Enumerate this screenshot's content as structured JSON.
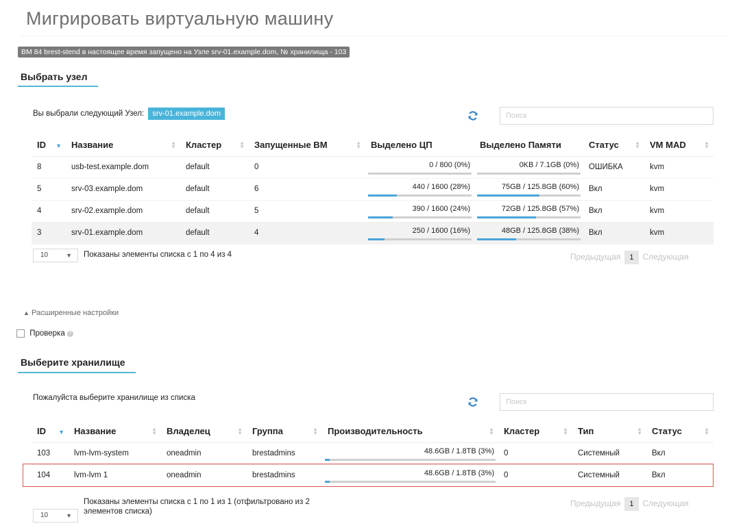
{
  "title": "Мигрировать виртуальную машину",
  "banner": "ВМ 84 brest-stend в настоящее время запущено на Узле srv-01.example.dom, № хранилища - 103",
  "host_section": {
    "title": "Выбрать узел",
    "selected_label": "Вы выбрали следующий Узел:",
    "selected_value": "srv-01.example.dom",
    "search_placeholder": "Поиск",
    "columns": [
      "ID",
      "Название",
      "Кластер",
      "Запущенные ВМ",
      "Выделено ЦП",
      "Выделено Памяти",
      "Статус",
      "VM MAD"
    ],
    "rows": [
      {
        "id": "8",
        "name": "usb-test.example.dom",
        "cluster": "default",
        "vms": "0",
        "cpu": "0 / 800 (0%)",
        "cpu_pct": 0,
        "mem": "0KB / 7.1GB (0%)",
        "mem_pct": 0,
        "status": "ОШИБКА",
        "vm_mad": "kvm"
      },
      {
        "id": "5",
        "name": "srv-03.example.dom",
        "cluster": "default",
        "vms": "6",
        "cpu": "440 / 1600 (28%)",
        "cpu_pct": 28,
        "mem": "75GB / 125.8GB (60%)",
        "mem_pct": 60,
        "status": "Вкл",
        "vm_mad": "kvm"
      },
      {
        "id": "4",
        "name": "srv-02.example.dom",
        "cluster": "default",
        "vms": "5",
        "cpu": "390 / 1600 (24%)",
        "cpu_pct": 24,
        "mem": "72GB / 125.8GB (57%)",
        "mem_pct": 57,
        "status": "Вкл",
        "vm_mad": "kvm"
      },
      {
        "id": "3",
        "name": "srv-01.example.dom",
        "cluster": "default",
        "vms": "4",
        "cpu": "250 / 1600 (16%)",
        "cpu_pct": 16,
        "mem": "48GB / 125.8GB (38%)",
        "mem_pct": 38,
        "status": "Вкл",
        "vm_mad": "kvm"
      }
    ],
    "page_size": "10",
    "info": "Показаны элементы списка с 1 по 4 из 4",
    "prev": "Предыдущая",
    "page": "1",
    "next": "Следующая"
  },
  "advanced_label": "Расширенные настройки",
  "check_label": "Проверка",
  "ds_section": {
    "title": "Выберите хранилище",
    "prompt": "Пожалуйста выберите хранилище из списка",
    "search_placeholder": "Поиск",
    "columns": [
      "ID",
      "Название",
      "Владелец",
      "Группа",
      "Производительность",
      "Кластер",
      "Тип",
      "Статус"
    ],
    "rows": [
      {
        "id": "103",
        "name": "lvm-lvm-system",
        "owner": "oneadmin",
        "group": "brestadmins",
        "capacity": "48.6GB / 1.8TB (3%)",
        "capacity_pct": 3,
        "cluster": "0",
        "type": "Системный",
        "status": "Вкл"
      },
      {
        "id": "104",
        "name": "lvm-lvm 1",
        "owner": "oneadmin",
        "group": "brestadmins",
        "capacity": "48.6GB / 1.8TB (3%)",
        "capacity_pct": 3,
        "cluster": "0",
        "type": "Системный",
        "status": "Вкл"
      }
    ],
    "page_size": "10",
    "info_line1": "Показаны элементы списка с 1 по 1 из 1 (отфильтровано из 2",
    "info_line2": "элементов списка)",
    "prev": "Предыдущая",
    "page": "1",
    "next": "Следующая"
  }
}
